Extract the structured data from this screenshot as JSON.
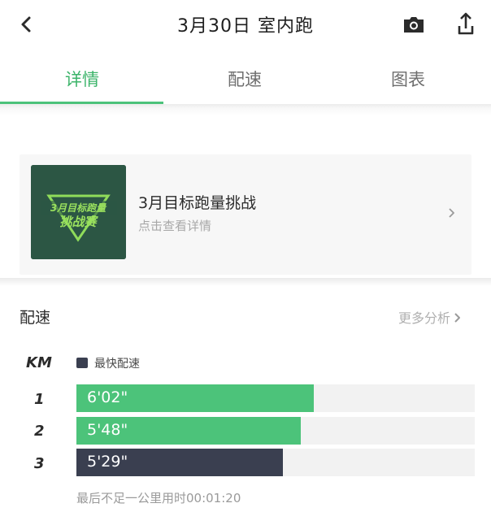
{
  "header": {
    "title": "3月30日 室内跑"
  },
  "tabs": [
    {
      "label": "详情",
      "active": true
    },
    {
      "label": "配速",
      "active": false
    },
    {
      "label": "图表",
      "active": false
    }
  ],
  "banner": {
    "title": "3月目标跑量挑战",
    "subtitle": "点击查看详情",
    "thumb_line1": "3月目标跑量",
    "thumb_line2": "挑战赛"
  },
  "pace": {
    "section_title": "配速",
    "more_label": "更多分析",
    "km_header": "KM",
    "legend_label": "最快配速",
    "rows": [
      {
        "km": "1",
        "pace": "6'02\"",
        "fraction": 0.595,
        "fastest": false
      },
      {
        "km": "2",
        "pace": "5'48\"",
        "fraction": 0.563,
        "fastest": false
      },
      {
        "km": "3",
        "pace": "5'29\"",
        "fraction": 0.518,
        "fastest": true
      }
    ],
    "footnote": "最后不足一公里用时00:01:20"
  },
  "colors": {
    "accent": "#3cb46a",
    "bar_normal": "#4cc37a",
    "bar_fastest": "#3a3f50",
    "track": "#f2f2f2"
  }
}
